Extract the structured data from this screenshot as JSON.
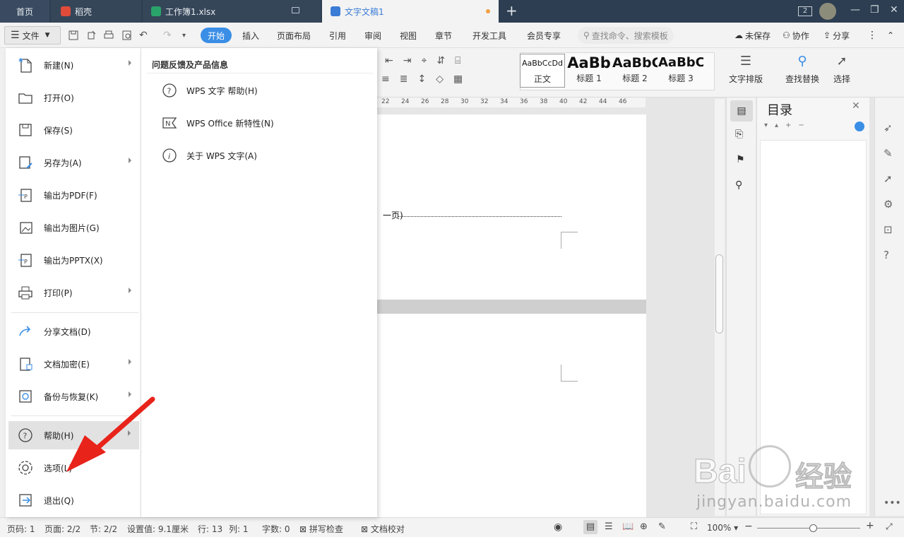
{
  "tabs": {
    "home": "首页",
    "daoke": "稻壳",
    "xlsx": "工作簿1.xlsx",
    "doc": "文字文稿1",
    "window_count": "2"
  },
  "toolbar": {
    "file": "文件",
    "menus": [
      "开始",
      "插入",
      "页面布局",
      "引用",
      "审阅",
      "视图",
      "章节",
      "开发工具",
      "会员专享"
    ],
    "search_placeholder": "查找命令、搜索模板",
    "unsaved": "未保存",
    "collab": "协作",
    "share": "分享"
  },
  "ribbon": {
    "styles": [
      {
        "sample": "AaBbCcDd",
        "label": "正文"
      },
      {
        "sample": "AaBb",
        "label": "标题 1"
      },
      {
        "sample": "AaBbC",
        "label": "标题 2"
      },
      {
        "sample": "AaBbC",
        "label": "标题 3"
      }
    ],
    "text_layout": "文字排版",
    "find_replace": "查找替换",
    "select": "选择"
  },
  "ruler_ticks": [
    "22",
    "24",
    "26",
    "28",
    "30",
    "32",
    "34",
    "36",
    "38",
    "40",
    "42",
    "44",
    "46"
  ],
  "document": {
    "toc_line_fragment": "一页)"
  },
  "toc_panel": {
    "title": "目录"
  },
  "file_menu": {
    "items": [
      {
        "label": "新建(N)",
        "icon": "new-doc-icon",
        "submenu": true
      },
      {
        "label": "打开(O)",
        "icon": "folder-icon",
        "submenu": false
      },
      {
        "label": "保存(S)",
        "icon": "save-icon",
        "submenu": false
      },
      {
        "label": "另存为(A)",
        "icon": "save-as-icon",
        "submenu": true
      },
      {
        "label": "输出为PDF(F)",
        "icon": "pdf-export-icon",
        "submenu": false
      },
      {
        "label": "输出为图片(G)",
        "icon": "image-export-icon",
        "submenu": false
      },
      {
        "label": "输出为PPTX(X)",
        "icon": "pptx-export-icon",
        "submenu": false
      },
      {
        "label": "打印(P)",
        "icon": "print-icon",
        "submenu": true
      },
      {
        "label": "分享文档(D)",
        "icon": "share-doc-icon",
        "submenu": false
      },
      {
        "label": "文档加密(E)",
        "icon": "encrypt-icon",
        "submenu": true
      },
      {
        "label": "备份与恢复(K)",
        "icon": "backup-icon",
        "submenu": true
      },
      {
        "label": "帮助(H)",
        "icon": "help-icon",
        "submenu": true
      },
      {
        "label": "选项(L)",
        "icon": "gear-icon",
        "submenu": false
      },
      {
        "label": "退出(Q)",
        "icon": "exit-icon",
        "submenu": false
      }
    ]
  },
  "help_submenu": {
    "title": "问题反馈及产品信息",
    "items": [
      {
        "label": "WPS 文字 帮助(H)",
        "icon": "question-icon"
      },
      {
        "label": "WPS Office 新特性(N)",
        "icon": "new-feature-icon"
      },
      {
        "label": "关于 WPS 文字(A)",
        "icon": "info-icon"
      }
    ]
  },
  "statusbar": {
    "page_no": "页码: 1",
    "pages": "页面: 2/2",
    "section": "节: 2/2",
    "setting": "设置值: 9.1厘米",
    "row": "行: 13",
    "col": "列: 1",
    "words": "字数: 0",
    "spell": "拼写检查",
    "proof": "文档校对",
    "zoom": "100%",
    "zoom_level": 0.55
  },
  "watermark": {
    "brand": "Bai",
    "brand_cn": "经验",
    "url": "jingyan.baidu.com"
  },
  "colors": {
    "accent": "#3a8ee6",
    "arrow": "#e8231a",
    "tabbar": "#2d3e52"
  }
}
